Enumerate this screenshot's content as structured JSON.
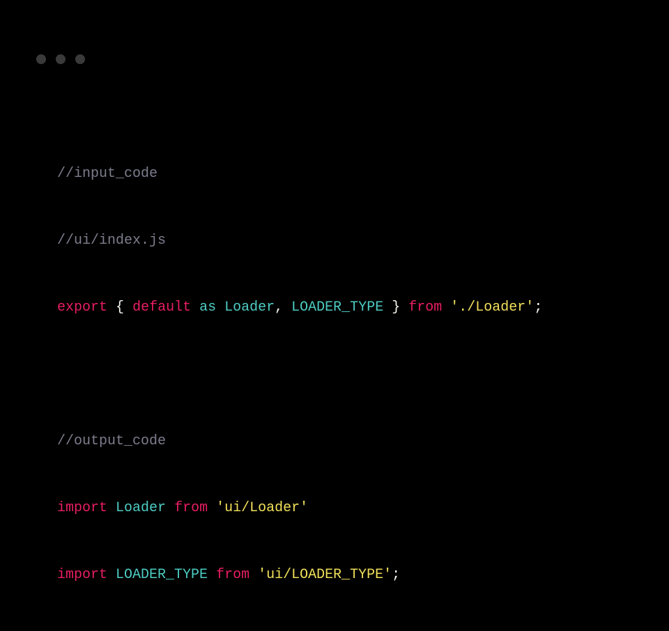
{
  "code": {
    "line1": "//input_code",
    "line2": "//ui/index.js",
    "line3": {
      "export": "export",
      "brace_open": "{",
      "default": "default",
      "as": "as",
      "id1": "Loader",
      "comma": ",",
      "id2": "LOADER_TYPE",
      "brace_close": "}",
      "from": "from",
      "path": "'./Loader'",
      "semi": ";"
    },
    "line5": "//output_code",
    "line6": {
      "import": "import",
      "id": "Loader",
      "from": "from",
      "path": "'ui/Loader'"
    },
    "line7": {
      "import": "import",
      "id": "LOADER_TYPE",
      "from": "from",
      "path": "'ui/LOADER_TYPE'",
      "semi": ";"
    }
  }
}
